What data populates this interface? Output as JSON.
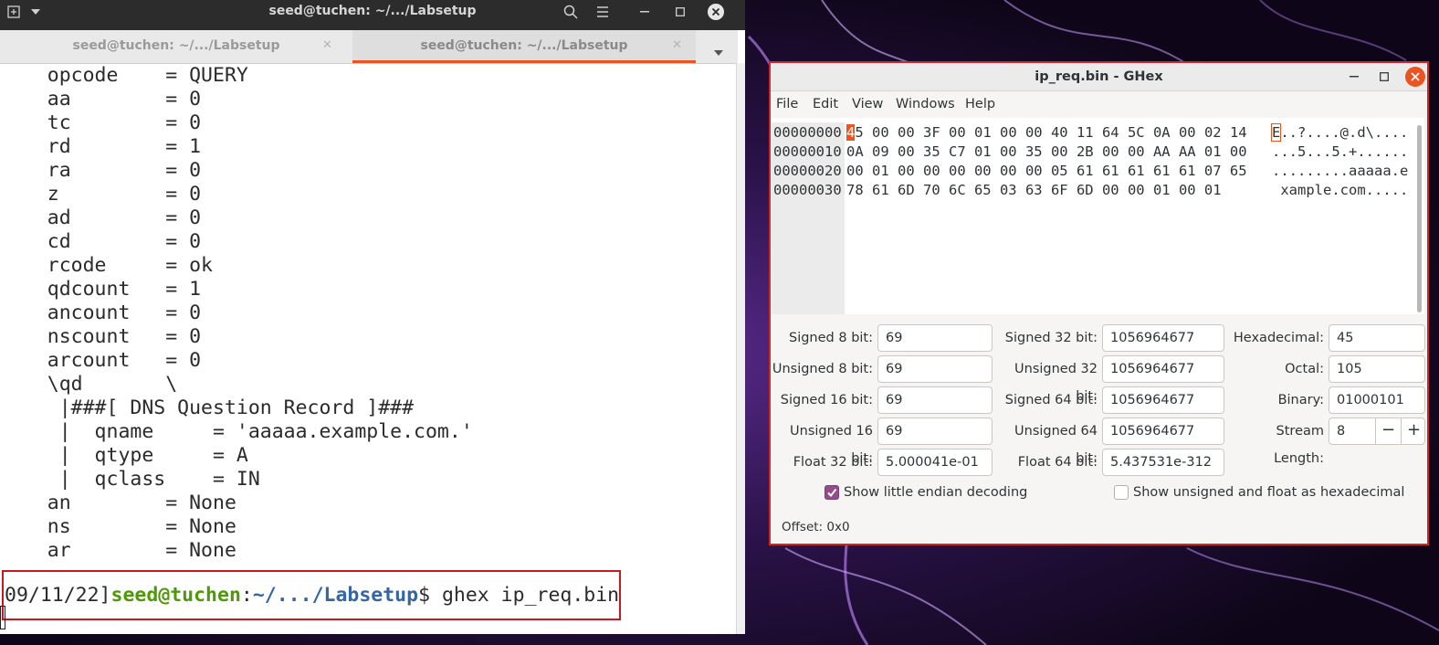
{
  "terminal": {
    "title": "seed@tuchen: ~/.../Labsetup",
    "tabs": [
      {
        "label": "seed@tuchen: ~/.../Labsetup",
        "active": false
      },
      {
        "label": "seed@tuchen: ~/.../Labsetup",
        "active": true
      }
    ],
    "lines": [
      "    opcode    = QUERY",
      "    aa        = 0",
      "    tc        = 0",
      "    rd        = 1",
      "    ra        = 0",
      "    z         = 0",
      "    ad        = 0",
      "    cd        = 0",
      "    rcode     = ok",
      "    qdcount   = 1",
      "    ancount   = 0",
      "    nscount   = 0",
      "    arcount   = 0",
      "    \\qd       \\",
      "     |###[ DNS Question Record ]###",
      "     |  qname     = 'aaaaa.example.com.'",
      "     |  qtype     = A",
      "     |  qclass    = IN",
      "    an        = None",
      "    ns        = None",
      "    ar        = None"
    ],
    "prompt": {
      "date": "09/11/22]",
      "user": "seed@tuchen",
      "colon": ":",
      "path": "~/.../Labsetup",
      "dollar": "$",
      "command": " ghex ip_req.bin"
    }
  },
  "ghex": {
    "title": "ip_req.bin - GHex",
    "menu": [
      "File",
      "Edit",
      "View",
      "Windows",
      "Help"
    ],
    "hex_rows": [
      {
        "offset": "00000000",
        "first": "4",
        "hex": "5 00 00 3F 00 01 00 00 40 11 64 5C 0A 00 02 14",
        "ascii_first": "E",
        "ascii": "..?....@.d\\...."
      },
      {
        "offset": "00000010",
        "first": "",
        "hex": "0A 09 00 35 C7 01 00 35 00 2B 00 00 AA AA 01 00",
        "ascii_first": "",
        "ascii": "...5...5.+......"
      },
      {
        "offset": "00000020",
        "first": "",
        "hex": "00 01 00 00 00 00 00 00 05 61 61 61 61 61 07 65",
        "ascii_first": "",
        "ascii": ".........aaaaa.e"
      },
      {
        "offset": "00000030",
        "first": "",
        "hex": "78 61 6D 70 6C 65 03 63 6F 6D 00 00 01 00 01",
        "ascii_first": "",
        "ascii": " xample.com....."
      }
    ],
    "fields": {
      "signed8_label": "Signed 8 bit:",
      "signed8": "69",
      "unsigned8_label": "Unsigned 8 bit:",
      "unsigned8": "69",
      "signed16_label": "Signed 16 bit:",
      "signed16": "69",
      "unsigned16_label": "Unsigned 16 bit:",
      "unsigned16": "69",
      "float32_label": "Float 32 bit:",
      "float32": "5.000041e-01",
      "signed32_label": "Signed 32 bit:",
      "signed32": "1056964677",
      "unsigned32_label": "Unsigned 32 bit:",
      "unsigned32": "1056964677",
      "signed64_label": "Signed 64 bit:",
      "signed64": "1056964677",
      "unsigned64_label": "Unsigned 64 bit:",
      "unsigned64": "1056964677",
      "float64_label": "Float 64 bit:",
      "float64": "5.437531e-312",
      "hex_label": "Hexadecimal:",
      "hex": "45",
      "octal_label": "Octal:",
      "octal": "105",
      "binary_label": "Binary:",
      "binary": "01000101",
      "stream_label": "Stream Length:",
      "stream": "8"
    },
    "checks": {
      "little_endian": "Show little endian decoding",
      "little_endian_checked": true,
      "unsigned_hex": "Show unsigned and float as hexadecimal",
      "unsigned_hex_checked": false
    },
    "status": "Offset: 0x0"
  },
  "colors": {
    "accent": "#e95420",
    "highlight_border": "#c8181f",
    "prompt_user": "#4e9a06",
    "prompt_path": "#3465a4",
    "checkbox": "#924d8b"
  }
}
